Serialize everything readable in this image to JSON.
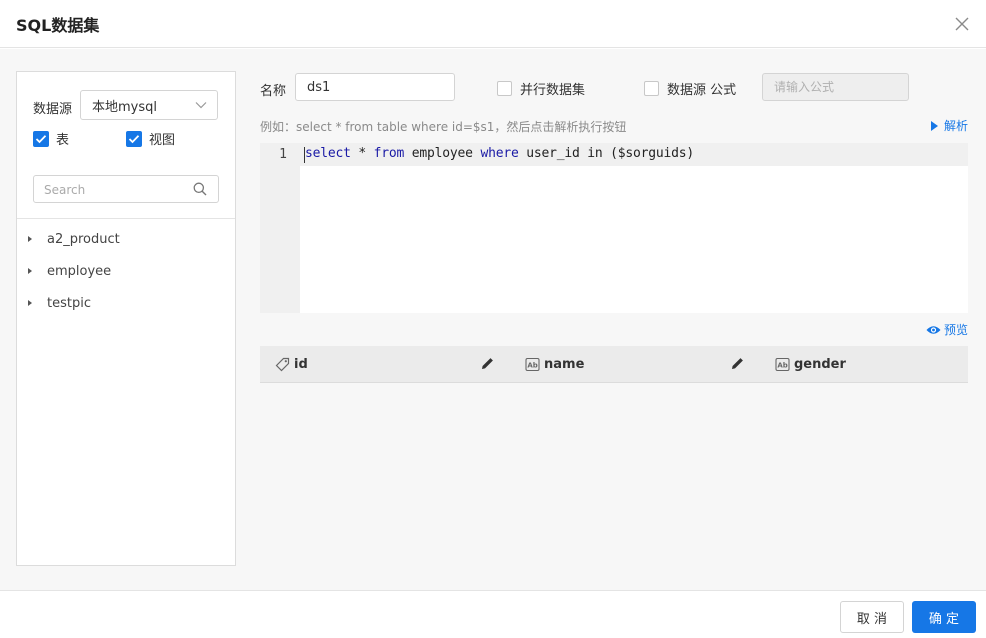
{
  "dialog": {
    "title": "SQL数据集",
    "close_icon": "close-icon"
  },
  "left": {
    "datasource_label": "数据源",
    "datasource_value": "本地mysql",
    "checks": [
      {
        "label": "表",
        "checked": true
      },
      {
        "label": "视图",
        "checked": true
      }
    ],
    "search_placeholder": "Search",
    "tree": [
      "a2_product",
      "employee",
      "testpic"
    ]
  },
  "form": {
    "name_label": "名称",
    "name_value": "ds1",
    "parallel_label": "并行数据集",
    "parallel_checked": false,
    "ds_formula_label": "数据源 公式",
    "ds_formula_checked": false,
    "formula_placeholder": "请输入公式",
    "hint": "例如：select * from table where id=$s1，然后点击解析执行按钮",
    "parse_label": "解析"
  },
  "editor": {
    "line_number": "1",
    "tokens": [
      "select",
      " * ",
      "from",
      " employee ",
      "where",
      " user_id in ($sorguids)"
    ]
  },
  "preview": {
    "label": "预览",
    "columns": [
      {
        "name": "id",
        "type_icon": "tag-icon"
      },
      {
        "name": "name",
        "type_icon": "text-field-icon"
      },
      {
        "name": "gender",
        "type_icon": "text-field-icon"
      }
    ]
  },
  "footer": {
    "cancel_label": "取 消",
    "ok_label": "确 定"
  },
  "colors": {
    "accent": "#1677e6",
    "keyword": "#1a1aa6"
  }
}
